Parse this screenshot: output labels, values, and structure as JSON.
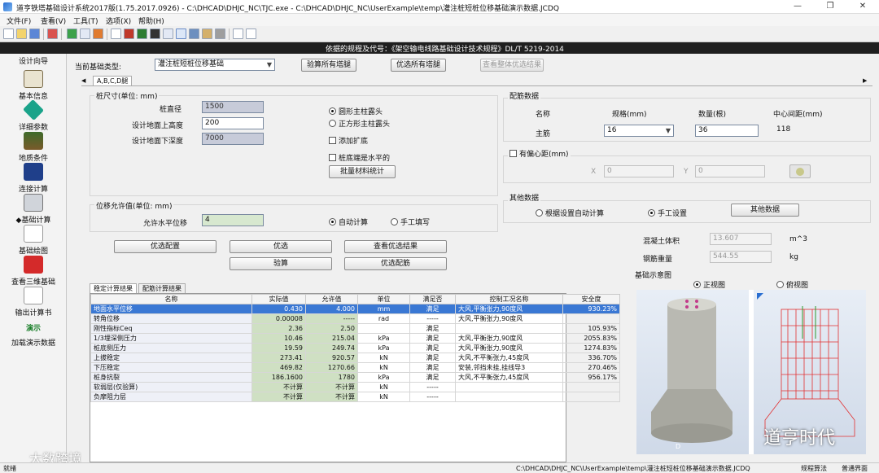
{
  "window": {
    "title": "道亨铁塔基础设计系统2017版(1.75.2017.0926) - C:\\DHCAD\\DHJC_NC\\TJC.exe - C:\\DHCAD\\DHJC_NC\\UserExample\\temp\\灌注桩短桩位移基础演示数据.JCDQ",
    "min": "—",
    "max": "❐",
    "close": "✕"
  },
  "menu": [
    {
      "label": "文件(F)"
    },
    {
      "label": "查看(V)"
    },
    {
      "label": "工具(T)"
    },
    {
      "label": "选项(X)"
    },
    {
      "label": "帮助(H)"
    }
  ],
  "toolbar_icons": [
    "new-icon",
    "open-icon",
    "save-icon",
    "print-icon",
    "calc-icon",
    "mark-icon",
    "tower-icon",
    "copy-icon",
    "book-icon",
    "image-icon",
    "report-icon",
    "chart-icon",
    "cursor-icon",
    "bars-icon",
    "notes-icon",
    "settings-icon",
    "help-icon",
    "question-icon"
  ],
  "info_bar": "依据的规程及代号：《架空输电线路基础设计技术规程》DL/T 5219-2014",
  "nav": {
    "header": "设计向导",
    "items": [
      {
        "label": "基本信息",
        "icon": "book-icon"
      },
      {
        "label": "详细参数",
        "icon": "diamond-icon"
      },
      {
        "label": "地质条件",
        "icon": "terrain-icon"
      },
      {
        "label": "连接计算",
        "icon": "connection-icon"
      },
      {
        "label": "◆基础计算",
        "icon": "foundation-calc-icon"
      },
      {
        "label": "基础绘图",
        "icon": "drawing-icon"
      },
      {
        "label": "查看三维基础",
        "icon": "cube-3d-icon"
      },
      {
        "label": "输出计算书",
        "icon": "report-output-icon"
      }
    ],
    "demo_label": "演示",
    "demo_load": "加载演示数据"
  },
  "top_row": {
    "type_label": "当前基础类型:",
    "type_value": "灌注桩短桩位移基础",
    "btn_check_all": "验算所有塔腿",
    "btn_opt_all": "优选所有塔腿",
    "btn_view_overall": "查看整体优选结果"
  },
  "tab": {
    "label": "A,B,C,D腿",
    "left_arrow": "◀",
    "right_arrow": "▶"
  },
  "pile": {
    "group_title": "桩尺寸(单位: mm)",
    "diameter_label": "桩直径",
    "diameter": "1500",
    "above_label": "设计地面上高度",
    "above": "200",
    "below_label": "设计地面下深度",
    "below": "7000",
    "radio_round": "圆形主柱露头",
    "radio_square": "正方形主柱露头",
    "chk_expand": "添加扩底",
    "chk_flat": "桩底端是水平的",
    "btn_batch": "批量材料统计"
  },
  "disp": {
    "group_title": "位移允许值(单位: mm)",
    "allow_label": "允许水平位移",
    "allow": "4",
    "radio_auto": "自动计算",
    "radio_manual": "手工填写"
  },
  "actions": {
    "opt_config": "优选配置",
    "optimize": "优选",
    "view_opt": "查看优选结果",
    "check": "验算",
    "opt_rebar": "优选配筋"
  },
  "rebar": {
    "group_title": "配筋数据",
    "col_name": "名称",
    "col_spec": "规格(mm)",
    "col_count": "数量(根)",
    "col_spacing": "中心间距(mm)",
    "row_name": "主筋",
    "spec": "16",
    "count": "36",
    "spacing": "118"
  },
  "eccentric": {
    "label": "有偏心距(mm)",
    "x_label": "X",
    "x": "0",
    "y_label": "Y",
    "y": "0"
  },
  "other": {
    "group_title": "其他数据",
    "radio_auto": "根据设置自动计算",
    "radio_manual": "手工设置",
    "btn_other": "其他数据"
  },
  "volumes": {
    "concrete_label": "混凝土体积",
    "concrete": "13.607",
    "concrete_unit": "m^3",
    "steel_label": "钢筋重量",
    "steel": "544.55",
    "steel_unit": "kg"
  },
  "preview": {
    "title": "基础示意图",
    "front": "正视图",
    "side": "俯视图",
    "axis_d": "D"
  },
  "results": {
    "tabs": [
      "稳定计算结果",
      "配筋计算结果"
    ],
    "columns": [
      "名称",
      "实际值",
      "允许值",
      "单位",
      "满足否",
      "控制工况名称",
      "安全度"
    ],
    "rows": [
      [
        "地面水平位移",
        "0.430",
        "4.000",
        "mm",
        "满足",
        "大风,平衡张力,90度风",
        "930.23%"
      ],
      [
        "转角位移",
        "0.00008",
        "-----",
        "rad",
        "-----",
        "大风,平衡张力,90度风",
        ""
      ],
      [
        "刚性指标Ceq",
        "2.36",
        "2.50",
        "",
        "满足",
        "",
        "105.93%"
      ],
      [
        "1/3埋深侧压力",
        "10.46",
        "215.04",
        "kPa",
        "满足",
        "大风,平衡张力,90度风",
        "2055.83%"
      ],
      [
        "桩底侧压力",
        "19.59",
        "249.74",
        "kPa",
        "满足",
        "大风,平衡张力,90度风",
        "1274.83%"
      ],
      [
        "上拔稳定",
        "273.41",
        "920.57",
        "kN",
        "满足",
        "大风,不平衡张力,45度风",
        "336.70%"
      ],
      [
        "下压稳定",
        "469.82",
        "1270.66",
        "kN",
        "满足",
        "安装,邻挡未挂,挂线导3",
        "270.46%"
      ],
      [
        "桩身抗裂",
        "186.1600",
        "1780",
        "kPa",
        "满足",
        "大风,不平衡张力,45度风",
        "956.17%"
      ],
      [
        "软弱层(仅验算)",
        "不计算",
        "不计算",
        "kN",
        "-----",
        "",
        ""
      ],
      [
        "负摩阻力层",
        "不计算",
        "不计算",
        "kN",
        "-----",
        "",
        ""
      ]
    ]
  },
  "status": {
    "left": "就绪",
    "path": "C:\\DHCAD\\DHJC_NC\\UserExample\\temp\\灌注桩短桩位移基础演示数据.JCDQ",
    "right1": "规程算法",
    "right2": "普通界面"
  },
  "watermarks": {
    "left": "大数跨境",
    "right": "道亨时代"
  },
  "colors": {
    "selection": "#3a78d4",
    "valueCell": "#cfe0c3",
    "readonly": "#c7cbd9",
    "infobar": "#1f1f1f"
  }
}
